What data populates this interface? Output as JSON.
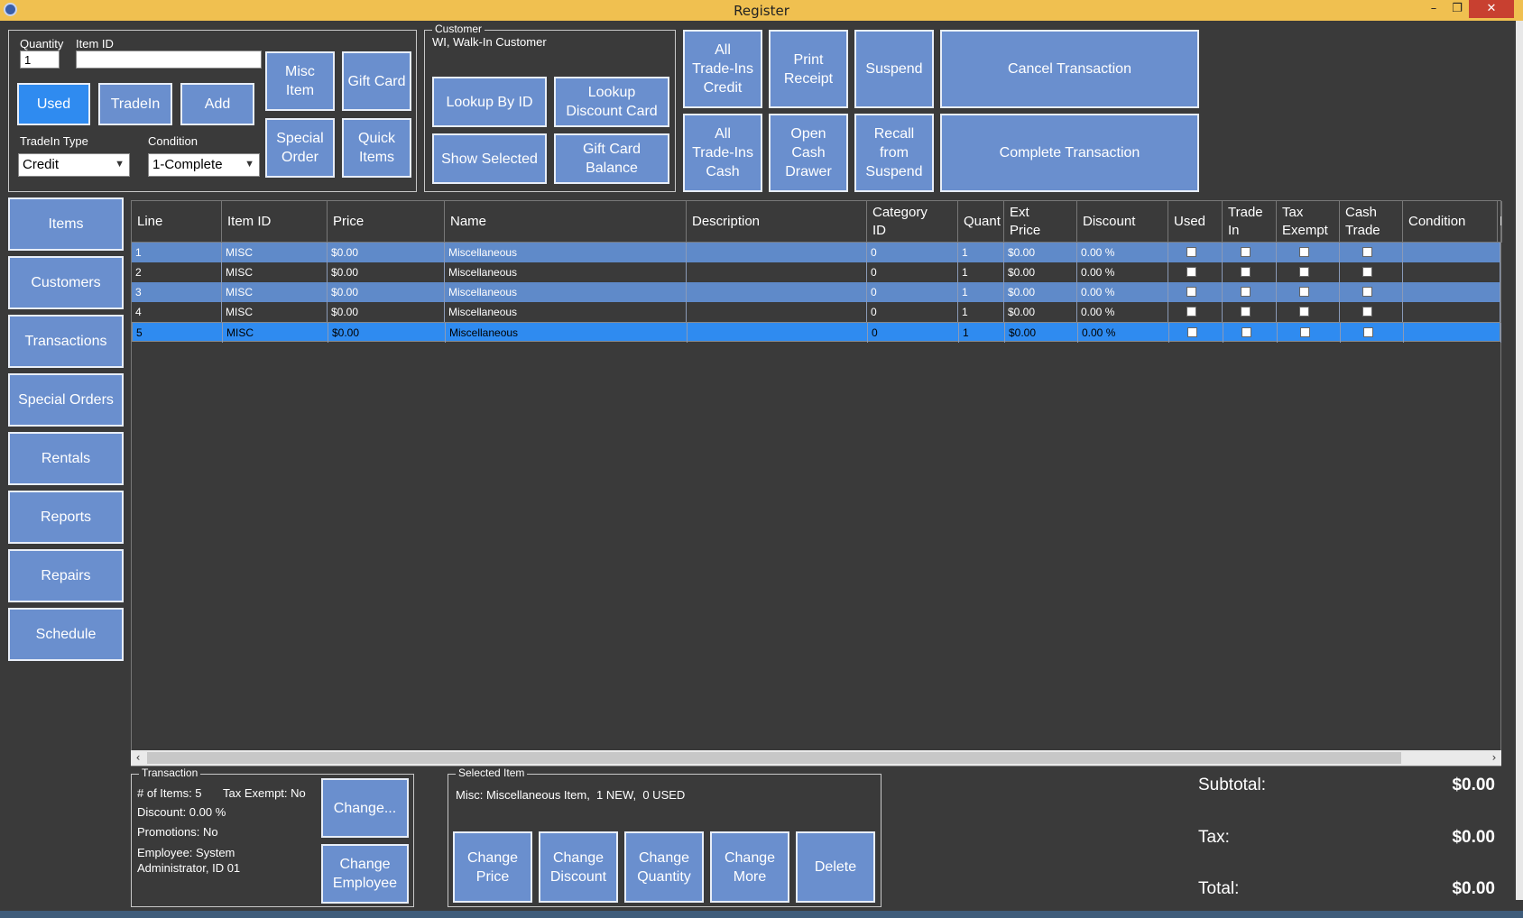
{
  "window": {
    "title": "Register",
    "minimize": "–",
    "restore": "❐",
    "close": "✕"
  },
  "entry": {
    "quantity_label": "Quantity",
    "quantity_value": "1",
    "item_id_label": "Item ID",
    "item_id_value": "",
    "used_label": "Used",
    "tradein_label": "TradeIn",
    "add_label": "Add",
    "tradein_type_label": "TradeIn Type",
    "tradein_type_value": "Credit",
    "condition_label": "Condition",
    "condition_value": "1-Complete",
    "misc_item_label": "Misc\nItem",
    "gift_card_label": "Gift Card",
    "special_order_label": "Special\nOrder",
    "quick_items_label": "Quick\nItems"
  },
  "customer": {
    "legend": "Customer",
    "name": "WI, Walk-In Customer",
    "lookup_by_id": "Lookup By ID",
    "lookup_discount_card": "Lookup\nDiscount Card",
    "show_selected": "Show Selected",
    "gift_card_balance": "Gift Card\nBalance"
  },
  "actions": {
    "all_tradeins_credit": "All\nTrade-Ins\nCredit",
    "print_receipt": "Print\nReceipt",
    "suspend": "Suspend",
    "cancel_transaction": "Cancel Transaction",
    "all_tradeins_cash": "All\nTrade-Ins\nCash",
    "open_cash_drawer": "Open\nCash\nDrawer",
    "recall_from_suspend": "Recall\nfrom\nSuspend",
    "complete_transaction": "Complete Transaction"
  },
  "nav": [
    "Items",
    "Customers",
    "Transactions",
    "Special Orders",
    "Rentals",
    "Reports",
    "Repairs",
    "Schedule"
  ],
  "grid": {
    "columns": [
      "Line",
      "Item ID",
      "Price",
      "Name",
      "Description",
      "Category\nID",
      "Quant",
      "Ext\nPrice",
      "Discount",
      "Used",
      "Trade\nIn",
      "Tax\nExempt",
      "Cash\nTrade",
      "Condition",
      "P"
    ],
    "rows": [
      {
        "line": "1",
        "item_id": "MISC",
        "price": "$0.00",
        "name": "Miscellaneous",
        "description": "",
        "category_id": "0",
        "quant": "1",
        "ext_price": "$0.00",
        "discount": "0.00 %",
        "condition": ""
      },
      {
        "line": "2",
        "item_id": "MISC",
        "price": "$0.00",
        "name": "Miscellaneous",
        "description": "",
        "category_id": "0",
        "quant": "1",
        "ext_price": "$0.00",
        "discount": "0.00 %",
        "condition": ""
      },
      {
        "line": "3",
        "item_id": "MISC",
        "price": "$0.00",
        "name": "Miscellaneous",
        "description": "",
        "category_id": "0",
        "quant": "1",
        "ext_price": "$0.00",
        "discount": "0.00 %",
        "condition": ""
      },
      {
        "line": "4",
        "item_id": "MISC",
        "price": "$0.00",
        "name": "Miscellaneous",
        "description": "",
        "category_id": "0",
        "quant": "1",
        "ext_price": "$0.00",
        "discount": "0.00 %",
        "condition": ""
      },
      {
        "line": "5",
        "item_id": "MISC",
        "price": "$0.00",
        "name": "Miscellaneous",
        "description": "",
        "category_id": "0",
        "quant": "1",
        "ext_price": "$0.00",
        "discount": "0.00 %",
        "condition": ""
      }
    ],
    "selected_row": "5"
  },
  "transaction": {
    "legend": "Transaction",
    "items_count": "# of Items: 5",
    "tax_exempt": "Tax Exempt: No",
    "discount": "Discount: 0.00 %",
    "promotions": "Promotions: No",
    "employee": "Employee: System\nAdministrator, ID 01",
    "change_label": "Change...",
    "change_employee_label": "Change\nEmployee"
  },
  "selected_item": {
    "legend": "Selected Item",
    "description": "Misc: Miscellaneous Item,  1 NEW,  0 USED",
    "change_price": "Change\nPrice",
    "change_discount": "Change\nDiscount",
    "change_quantity": "Change\nQuantity",
    "change_more": "Change\nMore",
    "delete": "Delete"
  },
  "totals": {
    "subtotal_label": "Subtotal:",
    "subtotal_value": "$0.00",
    "tax_label": "Tax:",
    "tax_value": "$0.00",
    "total_label": "Total:",
    "total_value": "$0.00"
  },
  "colors": {
    "button": "#6a8fce",
    "button_active": "#2f8bf0",
    "row_alt": "#5f8ac9",
    "background": "#3a3a3a",
    "titlebar": "#f0c050"
  }
}
